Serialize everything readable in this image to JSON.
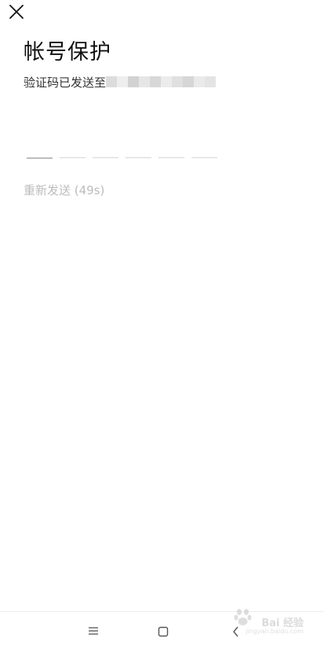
{
  "header": {
    "close_icon": "close-icon",
    "title": "帐号保护"
  },
  "verification": {
    "sent_to_label": "验证码已发送至",
    "masked_phone_colors": [
      "#dcdcdc",
      "#eeeeee",
      "#d2d2d2",
      "#e6e6e6",
      "#d8d8d8",
      "#ececec",
      "#e0e0e0",
      "#d6d6d6",
      "#eaeaea",
      "#e4e4e4"
    ],
    "code_length": 6,
    "filled_digits": 0
  },
  "resend": {
    "label": "重新发送 (49s)"
  },
  "nav_bar": {
    "menu_icon": "menu-icon",
    "home_icon": "home-square-icon",
    "back_icon": "back-chevron-icon"
  },
  "watermark": {
    "text": "Bai 经验",
    "url": "jingyan.baidu.com"
  },
  "colors": {
    "title": "#111111",
    "resend_disabled": "#bcbcbc",
    "underline": "#d6d6d6",
    "underline_active": "#bdbdbd"
  }
}
